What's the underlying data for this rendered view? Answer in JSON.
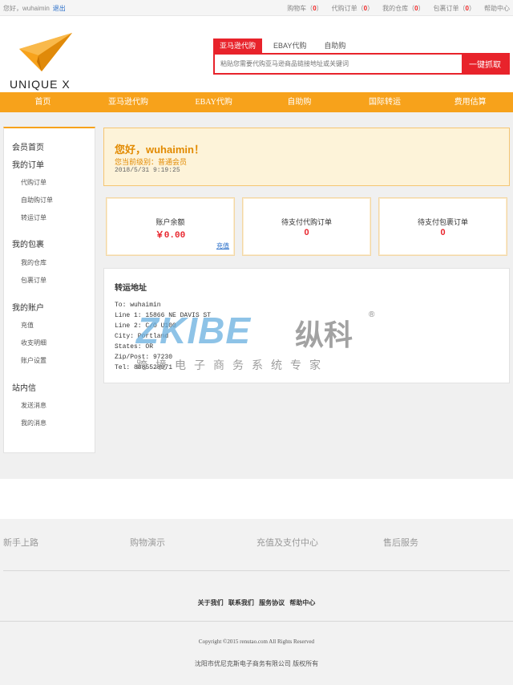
{
  "topbar": {
    "greeting": "您好，wuhaimin",
    "logout": "退出",
    "links": [
      {
        "label": "购物车（",
        "count": "0",
        "end": "）"
      },
      {
        "label": "代购订单（",
        "count": "0",
        "end": "）"
      },
      {
        "label": "我的仓库（",
        "count": "0",
        "end": "）"
      },
      {
        "label": "包裹订单（",
        "count": "0",
        "end": "）"
      },
      {
        "label": "帮助中心",
        "count": "",
        "end": ""
      }
    ]
  },
  "brand": {
    "name": "UNIQUE X",
    "accent": "#f7a21b"
  },
  "search": {
    "tabs": [
      "亚马逊代购",
      "EBAY代购",
      "自助购"
    ],
    "placeholder": "粘贴您需要代购亚马逊商品链接地址或关键词",
    "button": "一键抓取"
  },
  "nav": [
    "首页",
    "亚马逊代购",
    "EBAY代购",
    "自助购",
    "国际转运",
    "费用估算"
  ],
  "sidebar": {
    "home": "会员首页",
    "orders_head": "我的订单",
    "orders": [
      "代购订单",
      "自助购订单",
      "转运订单"
    ],
    "packages_head": "我的包裹",
    "packages": [
      "我的仓库",
      "包裹订单"
    ],
    "account_head": "我的账户",
    "account": [
      "充值",
      "收支明细",
      "账户设置"
    ],
    "messages_head": "站内信",
    "messages": [
      "发送消息",
      "我的消息"
    ]
  },
  "welcome": {
    "hello": "您好，wuhaimin！",
    "level": "您当前级别：普通会员",
    "date": "2018/5/31 9:19:25"
  },
  "cards": [
    {
      "label": "账户余额",
      "value": "￥0.00",
      "link": "充值"
    },
    {
      "label": "待支付代购订单",
      "value": "0",
      "link": ""
    },
    {
      "label": "待支付包裹订单",
      "value": "0",
      "link": ""
    }
  ],
  "address": {
    "title": "转运地址",
    "lines": [
      "To: wuhaimin",
      "Line 1: 15866 NE DAVIS ST",
      "Line 2: C/O U100",
      "City: Portland",
      "States: OR",
      "Zip/Post: 97230",
      "Tel: 8885528971"
    ]
  },
  "watermark": {
    "main": "ZKIBE",
    "cn": "纵科",
    "sub": "跨境电子商务系统专家",
    "reg": "®"
  },
  "footer": {
    "links": [
      "新手上路",
      "购物演示",
      "充值及支付中心",
      "售后服务"
    ],
    "bottom_links": [
      "关于我们",
      "联系我们",
      "服务协议",
      "帮助中心"
    ],
    "copyright": "Copyright ©2015 renutao.com All Rights Reserved",
    "company": "沈阳市优尼克斯电子商务有限公司 版权所有"
  }
}
